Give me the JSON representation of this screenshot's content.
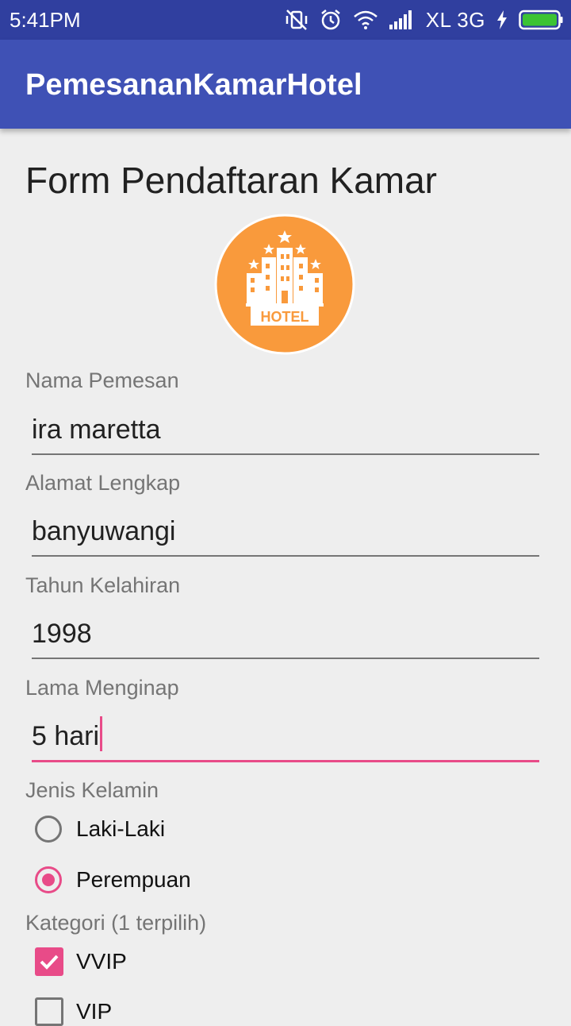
{
  "status_bar": {
    "time": "5:41PM",
    "carrier": "XL 3G",
    "icons": [
      "vibrate-off-icon",
      "alarm-icon",
      "wifi-icon",
      "signal-icon",
      "charging-icon",
      "battery-icon"
    ]
  },
  "app_bar": {
    "title": "PemesananKamarHotel"
  },
  "form": {
    "title": "Form Pendaftaran Kamar",
    "logo_text": "HOTEL",
    "fields": [
      {
        "label": "Nama Pemesan",
        "value": "ira maretta"
      },
      {
        "label": "Alamat Lengkap",
        "value": "banyuwangi"
      },
      {
        "label": "Tahun Kelahiran",
        "value": "1998"
      },
      {
        "label": "Lama Menginap",
        "value": "5 hari"
      }
    ],
    "gender": {
      "label": "Jenis Kelamin",
      "options": [
        "Laki-Laki",
        "Perempuan"
      ],
      "selected": "Perempuan"
    },
    "category": {
      "label": "Kategori (1 terpilih)",
      "options": [
        {
          "label": "VVIP",
          "checked": true
        },
        {
          "label": "VIP",
          "checked": false
        }
      ]
    }
  },
  "colors": {
    "status_bar": "#303f9f",
    "app_bar": "#3f51b5",
    "accent": "#e84b88",
    "logo_bg": "#f99a3c"
  }
}
